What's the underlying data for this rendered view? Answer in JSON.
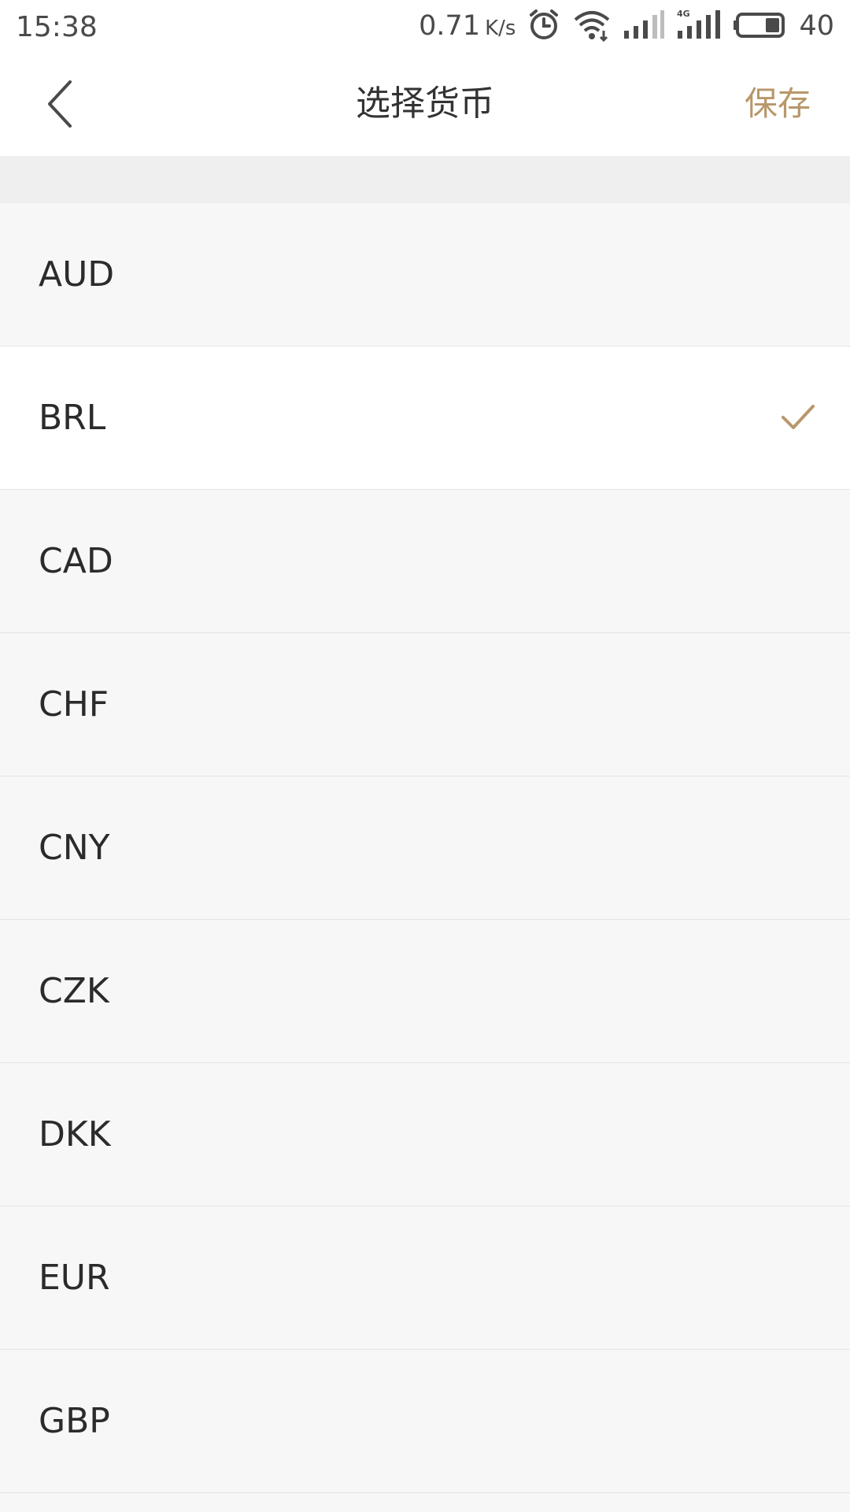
{
  "status_bar": {
    "time": "15:38",
    "net_speed_value": "0.71",
    "net_speed_unit": "K/s",
    "battery_level": "40",
    "icons": [
      "alarm-icon",
      "wifi-icon",
      "signal-icon",
      "signal-4g-icon",
      "battery-icon"
    ]
  },
  "header": {
    "title": "选择货币",
    "save_label": "保存",
    "back_icon": "chevron-left-icon"
  },
  "currency_list": {
    "selected": "BRL",
    "items": [
      {
        "code": "AUD"
      },
      {
        "code": "BRL"
      },
      {
        "code": "CAD"
      },
      {
        "code": "CHF"
      },
      {
        "code": "CNY"
      },
      {
        "code": "CZK"
      },
      {
        "code": "DKK"
      },
      {
        "code": "EUR"
      },
      {
        "code": "GBP"
      }
    ]
  },
  "colors": {
    "accent": "#b8976a",
    "list_background": "#f7f7f7",
    "selected_background": "#ffffff",
    "divider": "#e4e4e4",
    "section_gap": "#efefef"
  }
}
